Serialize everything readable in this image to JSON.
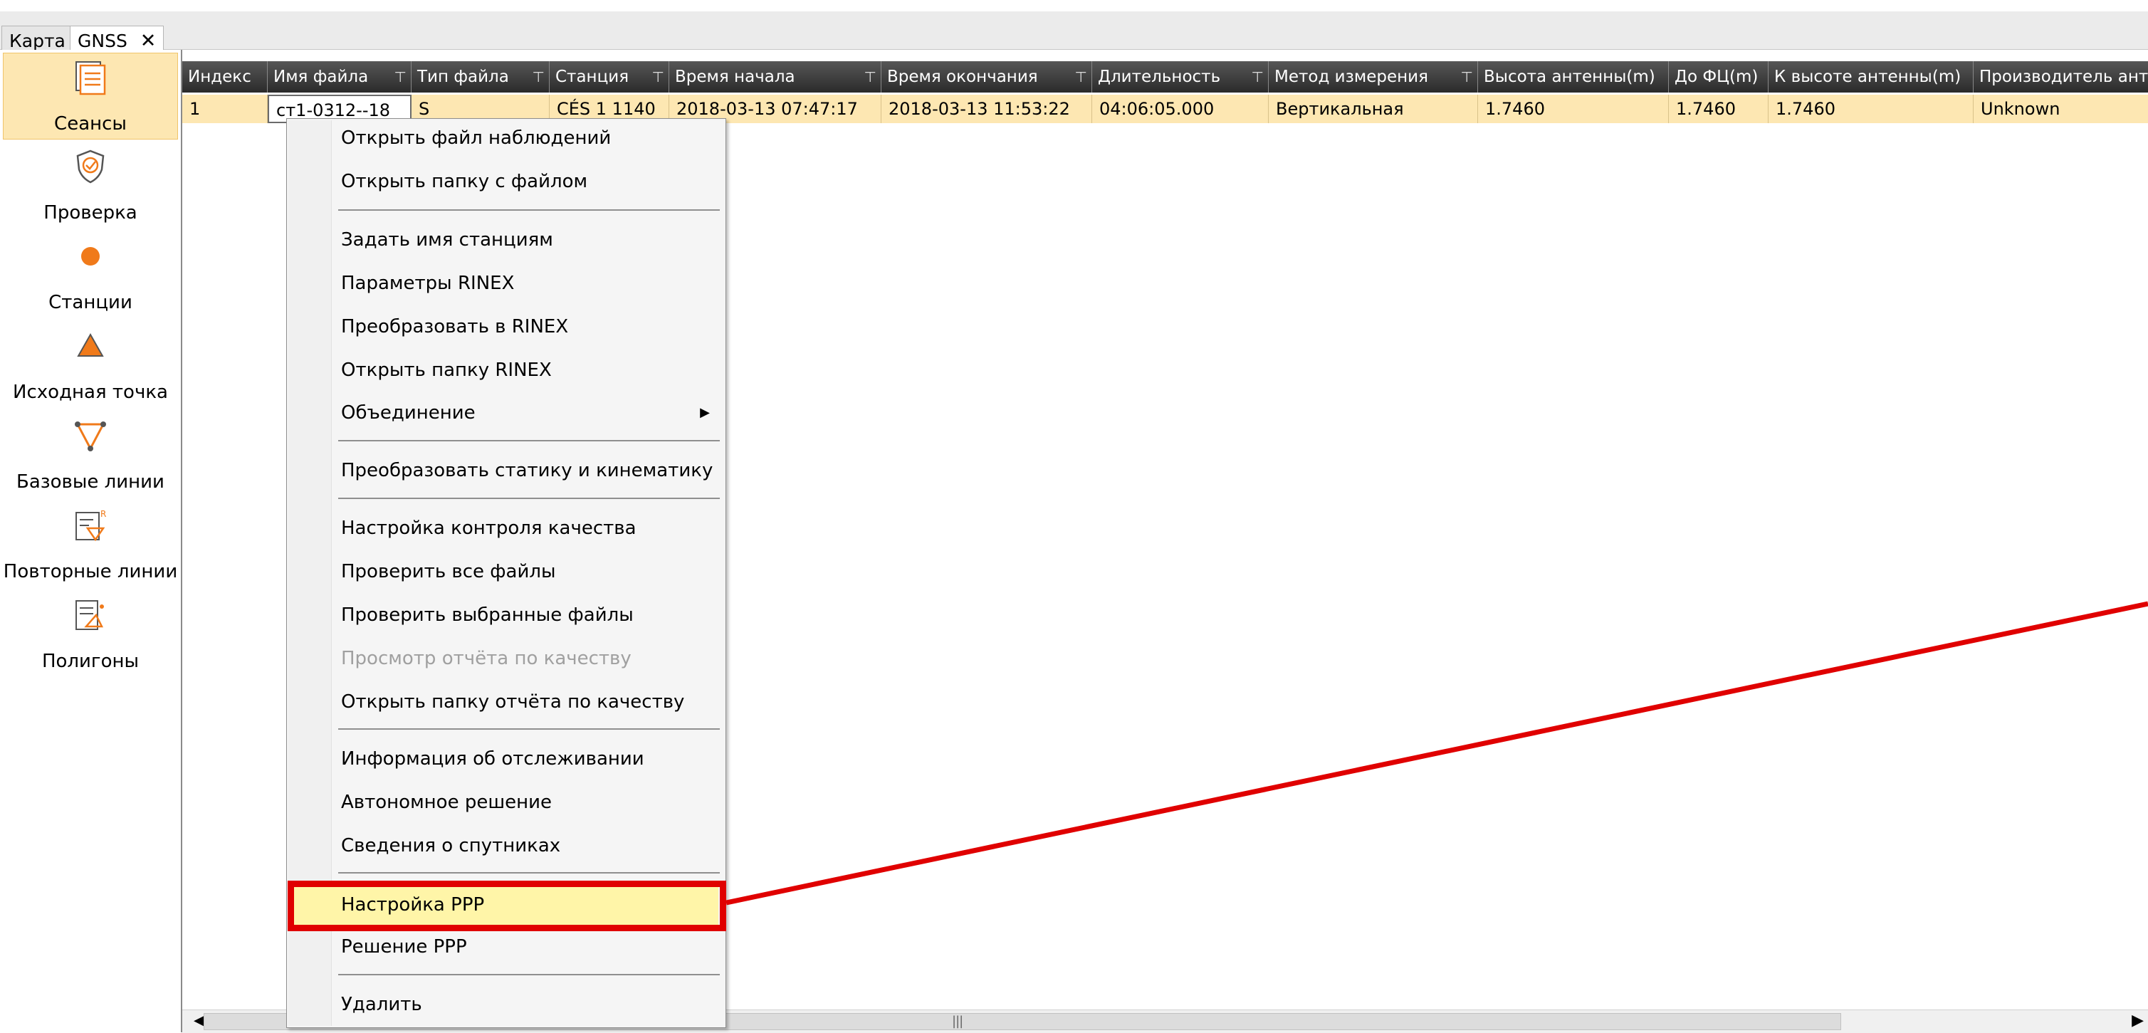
{
  "tabs": [
    {
      "label": "Карта"
    },
    {
      "label": "GNSS",
      "close_glyph": "✕"
    }
  ],
  "sidebar": {
    "items": [
      {
        "label": "Сеансы",
        "icon": "sessions-icon"
      },
      {
        "label": "Проверка",
        "icon": "qc-shield-icon"
      },
      {
        "label": "Станции",
        "icon": "station-dot-icon"
      },
      {
        "label": "Исходная точка",
        "icon": "control-point-triangle-icon"
      },
      {
        "label": "Базовые линии",
        "icon": "baseline-triangle-icon"
      },
      {
        "label": "Повторные линии",
        "icon": "repeat-baseline-icon"
      },
      {
        "label": "Полигоны",
        "icon": "loops-icon"
      }
    ]
  },
  "table": {
    "columns": [
      {
        "label": "Индекс",
        "filter": false
      },
      {
        "label": "Имя файла",
        "filter": true
      },
      {
        "label": "Тип файла",
        "filter": true
      },
      {
        "label": "Станция",
        "filter": true
      },
      {
        "label": "Время начала",
        "filter": true
      },
      {
        "label": "Время окончания",
        "filter": true
      },
      {
        "label": "Длительность",
        "filter": true
      },
      {
        "label": "Метод измерения",
        "filter": true
      },
      {
        "label": "Высота антенны(m)",
        "filter": false
      },
      {
        "label": "До ФЦ(m)",
        "filter": false
      },
      {
        "label": "К высоте антенны(m)",
        "filter": false
      },
      {
        "label": "Производитель анте",
        "filter": false
      }
    ],
    "filter_glyph": "⊤",
    "rows": [
      {
        "cells": [
          "1",
          "ст1-0312--18",
          "S",
          "CÉS 1 1140",
          "2018-03-13 07:47:17",
          "2018-03-13 11:53:22",
          "04:06:05.000",
          "Вертикальная",
          "1.7460",
          "1.7460",
          "1.7460",
          "Unknown"
        ]
      }
    ]
  },
  "context_menu": {
    "items": [
      {
        "label": "Открыть файл наблюдений"
      },
      {
        "label": "Открыть папку с файлом"
      },
      {
        "label": "Задать имя станциям"
      },
      {
        "label": "Параметры RINEX"
      },
      {
        "label": "Преобразовать в RINEX"
      },
      {
        "label": "Открыть папку RINEX"
      },
      {
        "label": "Объединение",
        "submenu_glyph": "▶"
      },
      {
        "label": "Преобразовать статику и кинематику"
      },
      {
        "label": "Настройка контроля качества"
      },
      {
        "label": "Проверить все файлы"
      },
      {
        "label": "Проверить выбранные файлы"
      },
      {
        "label": "Просмотр отчёта по качеству",
        "disabled": true
      },
      {
        "label": "Открыть папку отчёта по качеству"
      },
      {
        "label": "Информация об отслеживании"
      },
      {
        "label": "Автономное решение"
      },
      {
        "label": "Сведения о спутниках"
      },
      {
        "label": "Настройка PPP",
        "highlighted": true
      },
      {
        "label": "Решение PPP"
      },
      {
        "label": "Удалить"
      }
    ]
  },
  "scrollbar": {
    "left_arrow": "◀",
    "right_arrow": "▶",
    "grip": "|||"
  },
  "colors": {
    "accent_orange": "#f07a1a",
    "selection_row": "#fde7b2",
    "header_dark": "#3a3a3a",
    "annotation_red": "#e00000",
    "menu_highlight": "#fff5a8"
  }
}
